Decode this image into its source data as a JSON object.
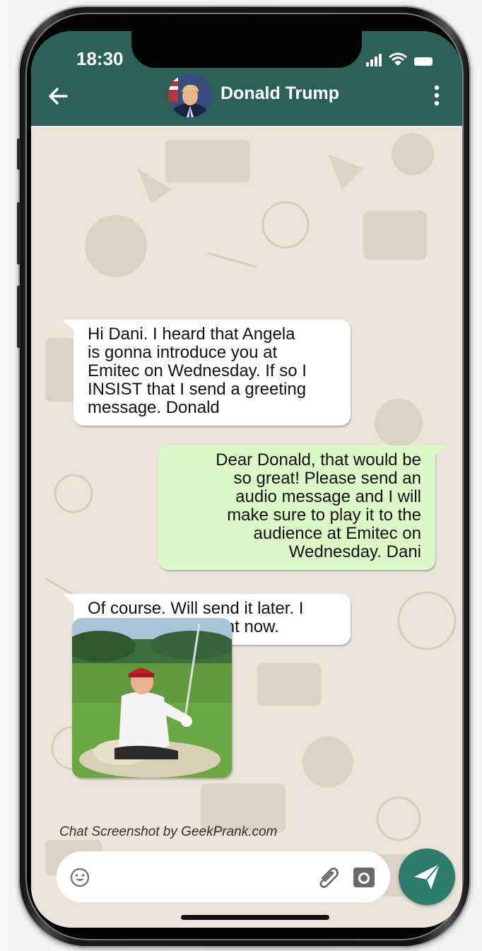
{
  "status_bar": {
    "time": "18:30"
  },
  "header": {
    "contact_name": "Donald Trump",
    "accent_color": "#2b6159"
  },
  "icons": {
    "back": "arrow-left-icon",
    "menu": "more-vertical-icon",
    "emoji": "emoji-icon",
    "attach": "paperclip-icon",
    "camera": "camera-icon",
    "send": "send-icon",
    "signal": "signal-icon",
    "wifi": "wifi-icon",
    "battery": "battery-icon"
  },
  "messages": [
    {
      "direction": "incoming",
      "text": "Hi Dani. I heard that Angela\nis gonna introduce you at\nEmitec on Wednesday. If so I\nINSIST that I send a greeting\nmessage. Donald"
    },
    {
      "direction": "outgoing",
      "text": "Dear Donald, that would be\nso great! Please send an\naudio message and I will\nmake sure to play it to the\naudience at Emitec on\nWednesday. Dani"
    },
    {
      "direction": "incoming",
      "text": "Of course. Will send it later. I\nam playing golf right now."
    },
    {
      "direction": "incoming",
      "type": "photo",
      "subject": "golfer-photo"
    }
  ],
  "watermark": "Chat Screenshot by GeekPrank.com",
  "colors": {
    "incoming_bubble": "#ffffff",
    "outgoing_bubble": "#dcf8c6",
    "send_button": "#2d7d6e"
  }
}
